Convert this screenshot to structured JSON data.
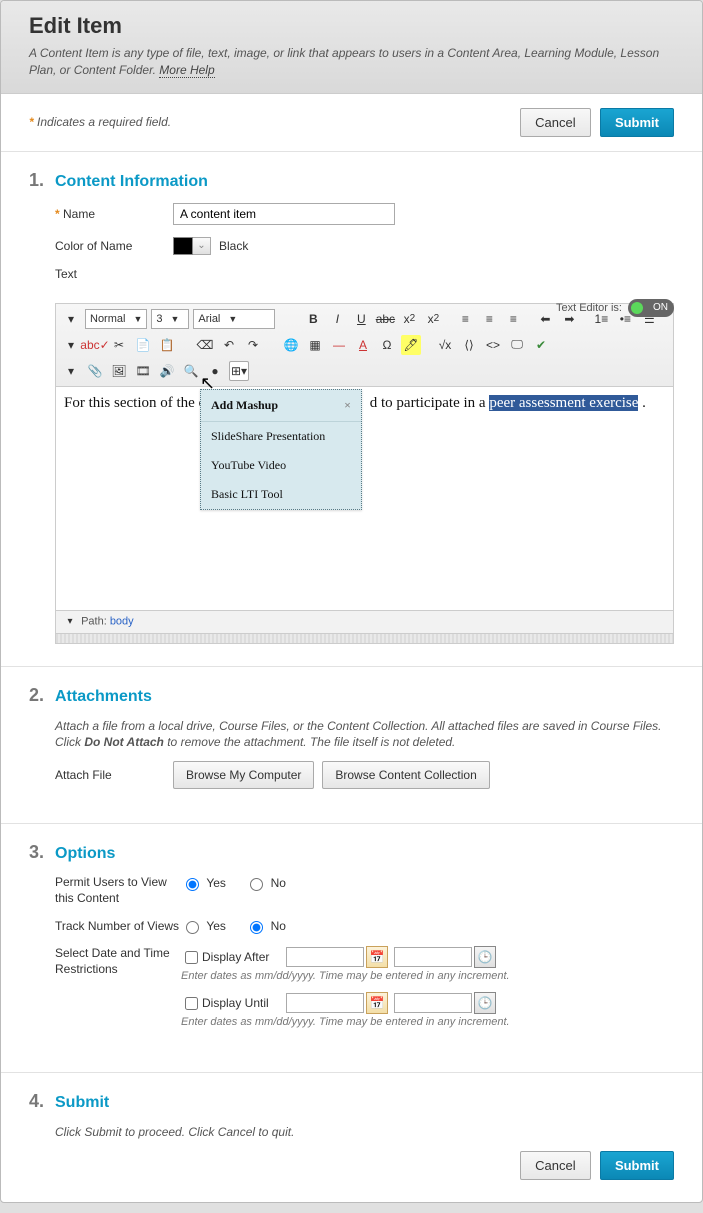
{
  "header": {
    "title": "Edit Item",
    "description": "A Content Item is any type of file, text, image, or link that appears to users in a Content Area, Learning Module, Lesson Plan, or Content Folder. ",
    "moreHelp": "More Help"
  },
  "required": {
    "star": "*",
    "text": "Indicates a required field."
  },
  "buttons": {
    "cancel": "Cancel",
    "submit": "Submit"
  },
  "step1": {
    "num": "1.",
    "title": "Content Information",
    "nameLbl": "Name",
    "nameVal": "A content item",
    "colorLbl": "Color of Name",
    "colorVal": "Black",
    "textLbl": "Text",
    "textEditorIs": "Text Editor is:",
    "toggleOn": "ON",
    "para": {
      "selNormal": "Normal",
      "selSize": "3",
      "selFont": "Arial"
    },
    "content": {
      "pre": "For this section of the c",
      "mid": "d to participate in a ",
      "highlight": "peer assessment exercise",
      "end": "."
    },
    "mashup": {
      "title": "Add Mashup",
      "items": [
        "SlideShare Presentation",
        "YouTube Video",
        "Basic LTI Tool"
      ]
    },
    "pathLbl": "Path:",
    "pathVal": "body"
  },
  "step2": {
    "num": "2.",
    "title": "Attachments",
    "note1": "Attach a file from a local drive, Course Files, or the Content Collection. All attached files are saved in Course Files. Click ",
    "noteBold": "Do Not Attach",
    "note2": " to remove the attachment. The file itself is not deleted.",
    "attachLbl": "Attach File",
    "browseComputer": "Browse My Computer",
    "browseContent": "Browse Content Collection"
  },
  "step3": {
    "num": "3.",
    "title": "Options",
    "permitLbl": "Permit Users to View this Content",
    "trackLbl": "Track Number of Views",
    "dateLbl": "Select Date and Time Restrictions",
    "yes": "Yes",
    "no": "No",
    "displayAfter": "Display After",
    "displayUntil": "Display Until",
    "dateNote": "Enter dates as mm/dd/yyyy. Time may be entered in any increment."
  },
  "step4": {
    "num": "4.",
    "title": "Submit",
    "note": "Click Submit to proceed. Click Cancel to quit."
  }
}
